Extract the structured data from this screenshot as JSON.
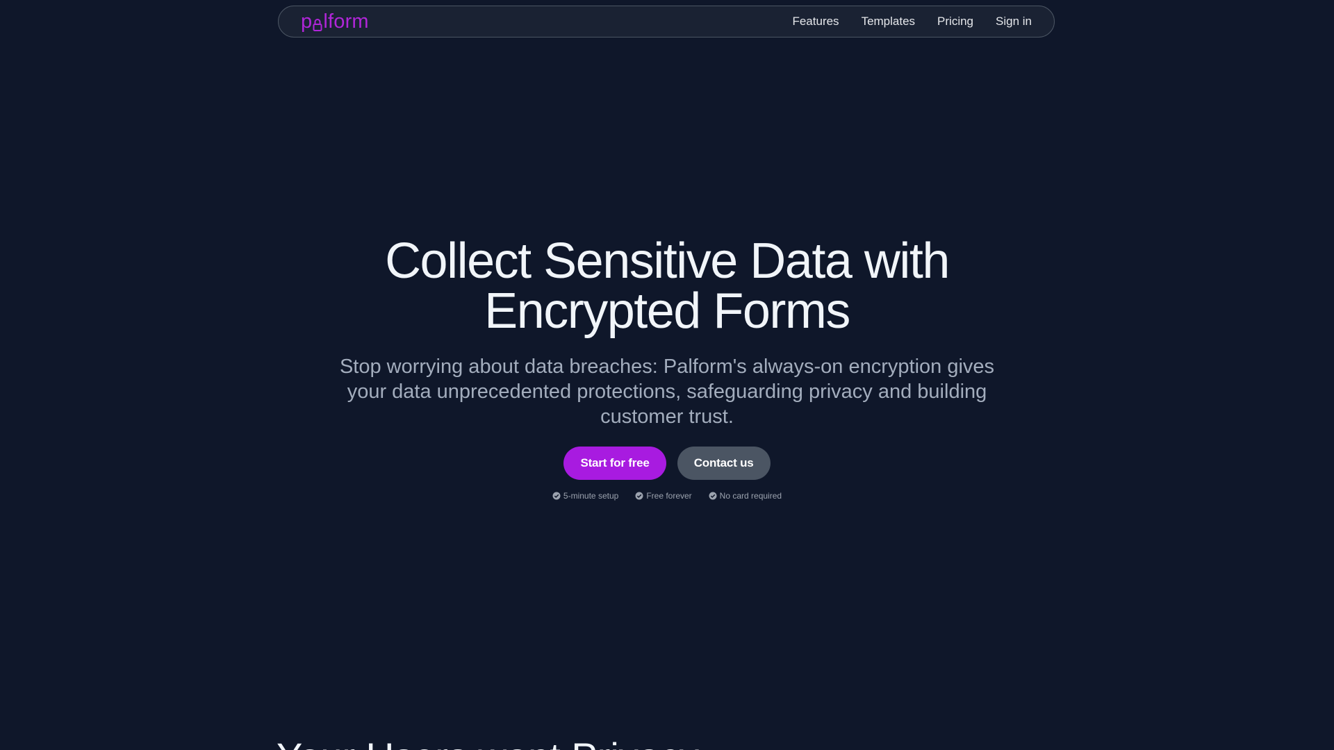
{
  "nav": {
    "logo_before": "p",
    "logo_after": "lform",
    "links": [
      "Features",
      "Templates",
      "Pricing",
      "Sign in"
    ]
  },
  "hero": {
    "title_line1": "Collect Sensitive Data with",
    "title_line2": "Encrypted Forms",
    "subtitle": "Stop worrying about data breaches: Palform's always-on encryption gives your data unprecedented protections, safeguarding privacy and building customer trust.",
    "primary_cta": "Start for free",
    "secondary_cta": "Contact us",
    "perks": [
      "5-minute setup",
      "Free forever",
      "No card required"
    ]
  },
  "next_section": {
    "heading": "Your Users want Privacy"
  },
  "colors": {
    "background": "#0f172a",
    "brand": "#a81be0",
    "secondary_button": "#4b5563"
  },
  "icons": {
    "logo_letter_a": "lock-icon",
    "perk": "check-circle-icon"
  }
}
